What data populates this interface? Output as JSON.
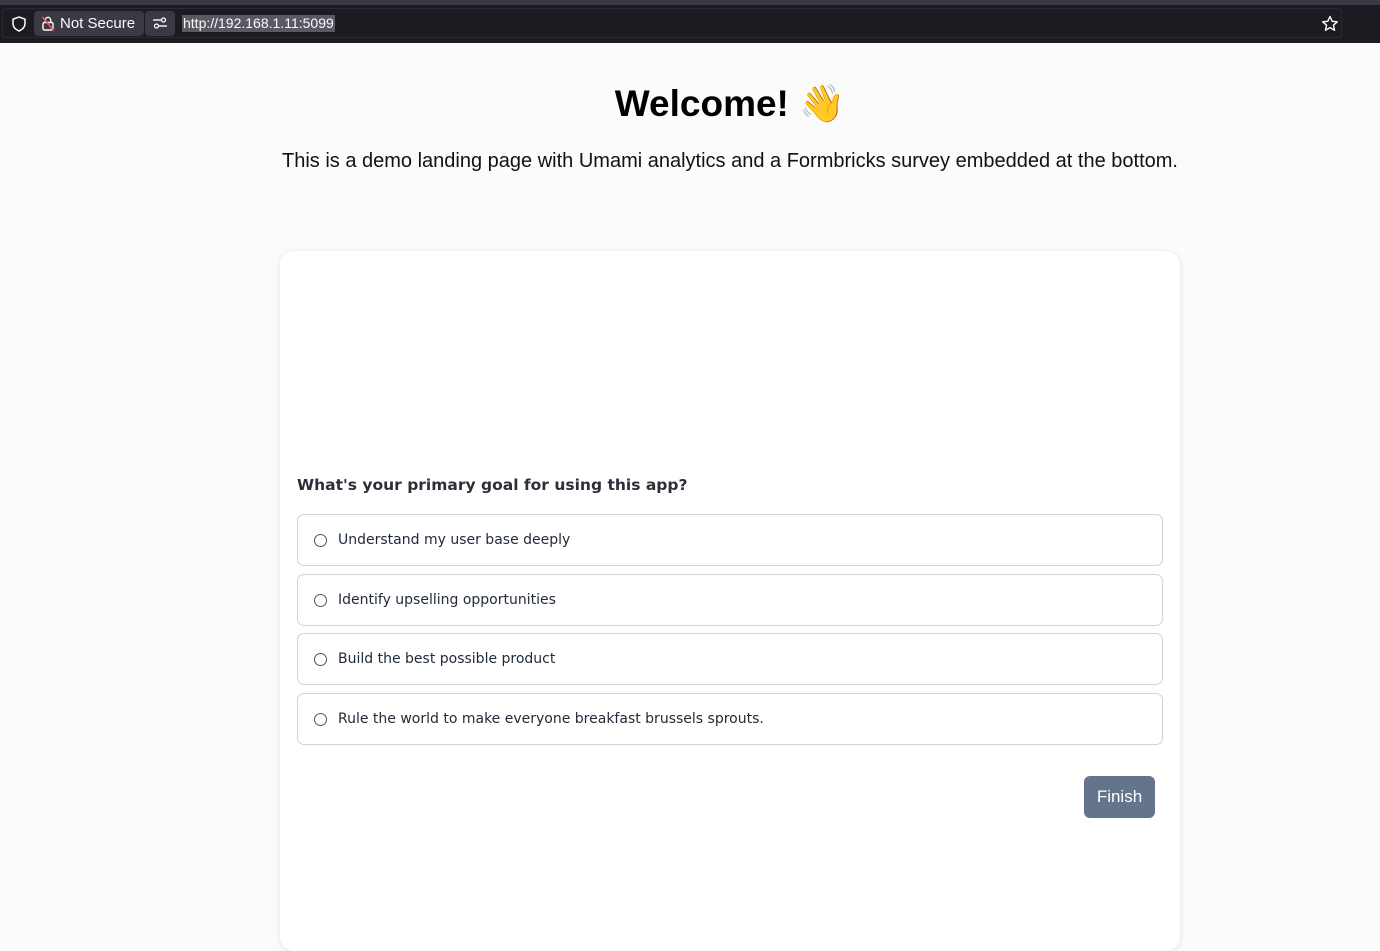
{
  "browser": {
    "security_label": "Not Secure",
    "url": "http://192.168.1.11:5099"
  },
  "page": {
    "title": "Welcome! 👋",
    "subtitle": "This is a demo landing page with Umami analytics and a Formbricks survey embedded at the bottom."
  },
  "survey": {
    "question": "What's your primary goal for using this app?",
    "options": [
      "Understand my user base deeply",
      "Identify upselling opportunities",
      "Build the best possible product",
      "Rule the world to make everyone breakfast brussels sprouts."
    ],
    "submit_label": "Finish",
    "button_color": "#64748b"
  }
}
